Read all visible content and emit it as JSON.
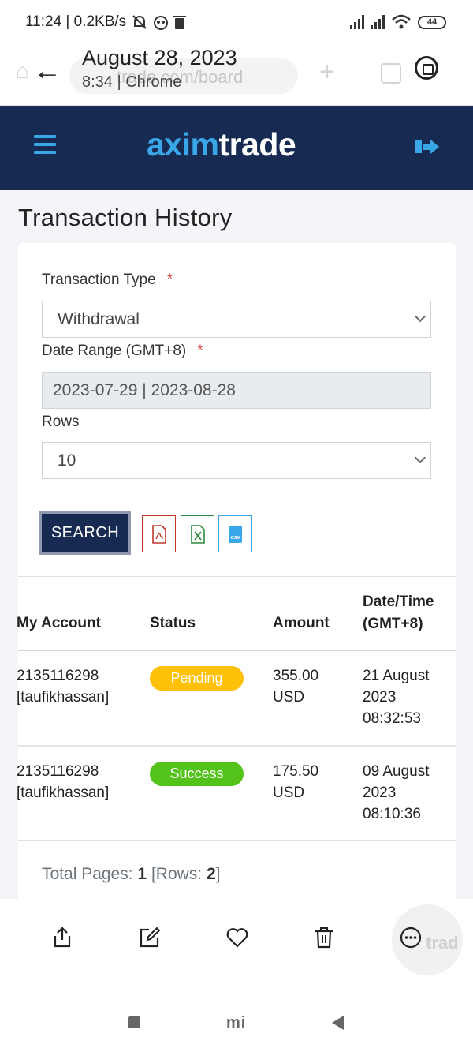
{
  "status_bar": {
    "time_and_speed": "11:24 | 0.2KB/s",
    "battery": "44",
    "wifi_sub": "6"
  },
  "chrome": {
    "title_date": "August 28, 2023",
    "subtitle": "8:34 | Chrome",
    "ghost_url": "trade.com/board"
  },
  "site": {
    "logo_part1": "axim",
    "logo_part2": "trade",
    "brand_color": "#172b52",
    "accent_color": "#39a7e7"
  },
  "page": {
    "title": "Transaction History"
  },
  "form": {
    "transaction_type_label": "Transaction Type",
    "transaction_type_value": "Withdrawal",
    "date_range_label": "Date Range (GMT+8)",
    "date_range_value": "2023-07-29 | 2023-08-28",
    "rows_label": "Rows",
    "rows_value": "10",
    "required_mark": "*",
    "search_label": "SEARCH",
    "export_pdf_icon": "pdf-icon",
    "export_excel_icon": "excel-icon",
    "export_csv_label": "csv"
  },
  "table": {
    "headers": {
      "account": "My Account",
      "status": "Status",
      "amount": "Amount",
      "datetime_line1": "Date/Time",
      "datetime_line2": "(GMT+8)"
    },
    "rows": [
      {
        "account_id": "2135116298",
        "account_name": "[taufikhassan]",
        "status": "Pending",
        "status_color": "#ffc107",
        "amount": "355.00",
        "currency": "USD",
        "date_line1": "21 August",
        "date_line2": "2023",
        "time": "08:32:53"
      },
      {
        "account_id": "2135116298",
        "account_name": "[taufikhassan]",
        "status": "Success",
        "status_color": "#53c31b",
        "amount": "175.50",
        "currency": "USD",
        "date_line1": "09 August",
        "date_line2": "2023",
        "time": "08:10:36"
      }
    ]
  },
  "footer": {
    "total_pages_label": "Total Pages:",
    "total_pages": "1",
    "rows_label": "[Rows:",
    "rows": "2",
    "rows_close": "]"
  },
  "toolbar": {
    "icons": [
      "share-icon",
      "edit-icon",
      "heart-icon",
      "trash-icon",
      "more-icon"
    ]
  },
  "navbar": {
    "home_label": "mi"
  }
}
